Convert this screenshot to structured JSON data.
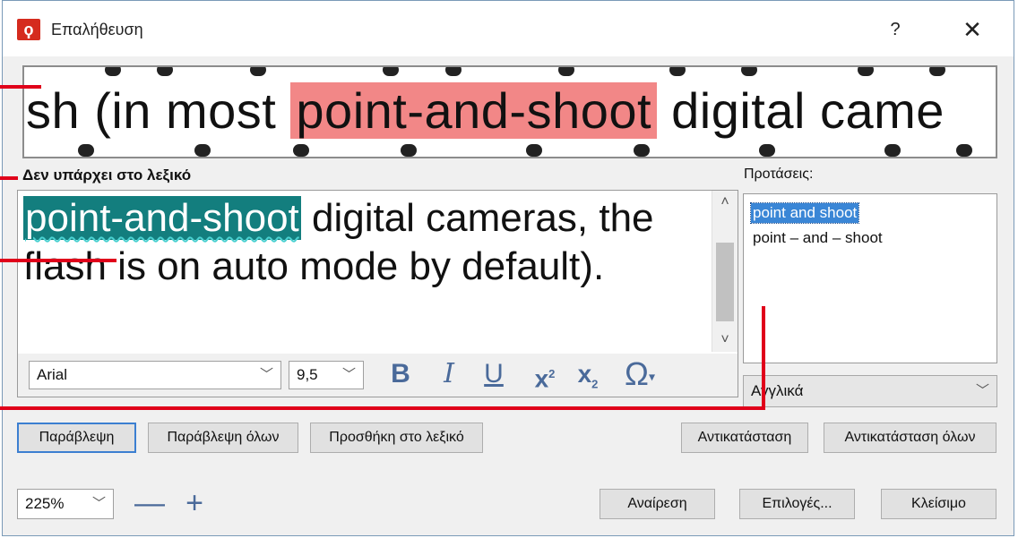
{
  "window": {
    "title": "Επαλήθευση",
    "app_icon": "ϙ",
    "help_label": "?",
    "close_label": "✕"
  },
  "preview": {
    "before": "sh (in most ",
    "highlighted": "point-and-shoot",
    "after": " digital came"
  },
  "labels": {
    "not_in_dictionary": "Δεν υπάρχει στο λεξικό",
    "suggestions": "Προτάσεις:"
  },
  "context": {
    "error_word": "point-and-shoot",
    "rest": " digital cameras, the flash is on auto mode by default)."
  },
  "format": {
    "font": "Arial",
    "size": "9,5",
    "bold": "B",
    "italic": "I",
    "underline": "U",
    "superscript": "x",
    "superscript_mark": "2",
    "subscript": "x",
    "subscript_mark": "2",
    "symbol": "Ω",
    "symbol_arrow": "▾"
  },
  "suggestions": [
    "point and shoot",
    "point – and – shoot"
  ],
  "language": "Αγγλικά",
  "buttons": {
    "ignore": "Παράβλεψη",
    "ignore_all": "Παράβλεψη όλων",
    "add_to_dictionary": "Προσθήκη στο λεξικό",
    "replace": "Αντικατάσταση",
    "replace_all": "Αντικατάσταση όλων",
    "undo": "Αναίρεση",
    "options": "Επιλογές...",
    "close": "Κλείσιμο"
  },
  "zoom": {
    "value": "225%",
    "minus": "—",
    "plus": "+"
  },
  "colors": {
    "highlight_preview": "#f28787",
    "error_word_bg": "#137e7e",
    "selection": "#3a86d6",
    "callout": "#e0001a"
  }
}
